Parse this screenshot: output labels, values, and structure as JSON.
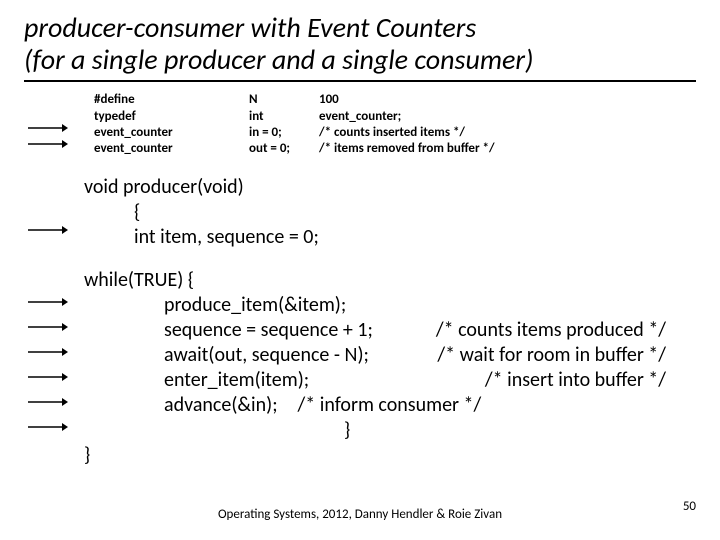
{
  "title_line1": "producer-consumer with Event  Counters",
  "title_line2": "(for a single producer and a single consumer)",
  "defs": {
    "c1": [
      "#define",
      "typedef",
      "event_counter",
      "event_counter"
    ],
    "c2": [
      "N",
      "int",
      "in = 0;",
      "out = 0;"
    ],
    "c3": [
      "100",
      "event_counter;",
      "/* counts inserted items */",
      "/* items removed from buffer */"
    ]
  },
  "code": {
    "sig": "void producer(void)",
    "brace": "{",
    "decl": "int  item, sequence = 0;",
    "while": "while(TRUE)  {",
    "l1": "produce_item(&item);",
    "l2": "sequence = sequence + 1;",
    "l2c": "/* counts items produced */",
    "l3": "await(out, sequence - N);",
    "l3c": "/* wait for room in buffer */",
    "l4": "enter_item(item);",
    "l4c": "/* insert into buffer */",
    "l5": "advance(&in);",
    "l5c": "/* inform consumer */",
    "close_inner": "}",
    "close_outer": "}"
  },
  "footer": "Operating Systems, 2012,  Danny Hendler & Roie Zivan",
  "pagenum": "50"
}
